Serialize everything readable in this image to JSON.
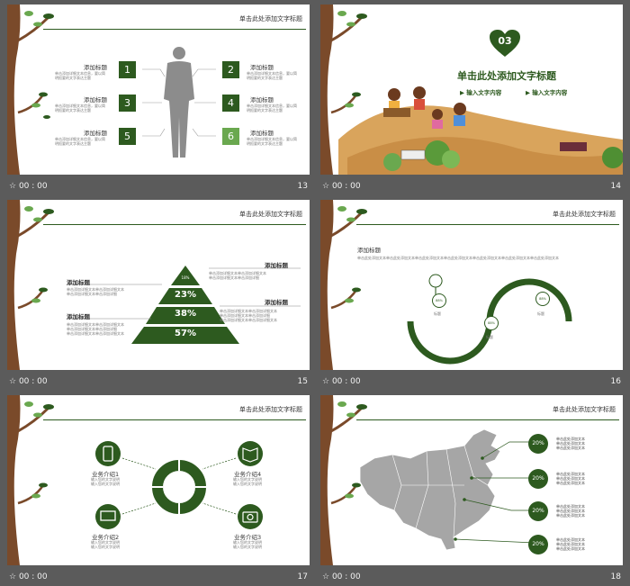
{
  "footer_time": "00 : 00",
  "slide_numbers": [
    "13",
    "14",
    "15",
    "16",
    "17",
    "18"
  ],
  "colors": {
    "dark_green": "#2d5a1f",
    "light_green": "#6aa84f",
    "bark": "#7a4a2a",
    "bg": "#5b5b5b"
  },
  "s13": {
    "title": "单击此处添加文字标题",
    "item_title": "添加标题",
    "item_text_1": "单击添加详细文本信息，要以简",
    "item_text_2": "明扼要的文字表达主题",
    "numbers": [
      "1",
      "2",
      "3",
      "4",
      "5",
      "6"
    ]
  },
  "s14": {
    "badge": "03",
    "title": "单击此处添加文字标题",
    "sub1": "输入文字内容",
    "sub2": "输入文字内容"
  },
  "s15": {
    "title": "单击此处添加文字标题",
    "label": "添加标题",
    "desc_1": "单击添加详细文本单击添加详细文本",
    "desc_2": "单击添加详细文本单击添加详细",
    "pcts": [
      "18%",
      "23%",
      "38%",
      "57%"
    ]
  },
  "s16": {
    "title": "单击此处添加文字标题",
    "heading": "添加标题",
    "para": "单击此处添加文本单击此处添加文本单击此处添加文本单击此处添加文本单击此处添加文本单击此处添加文本单击此处添加文本",
    "pins": [
      "88%",
      "88%",
      "88%",
      "88%"
    ],
    "pin_label": "标题"
  },
  "s17": {
    "title": "单击此处添加文字标题",
    "biz": [
      "业务介绍1",
      "业务介绍2",
      "业务介绍3",
      "业务介绍4"
    ],
    "biz_desc": "输入您的文字说明"
  },
  "s18": {
    "title": "单击此处添加文字标题",
    "pct": "20%",
    "desc_1": "单击此处添加文本",
    "desc_2": "单击此处添加文本"
  }
}
